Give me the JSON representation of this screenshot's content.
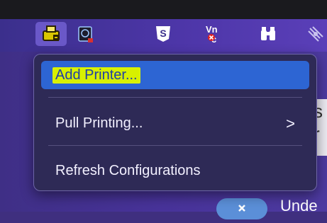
{
  "menubar": {
    "icons": [
      {
        "name": "printer-icon",
        "active": true
      },
      {
        "name": "capture-icon",
        "active": false
      },
      {
        "name": "s-badge-icon",
        "active": false
      },
      {
        "name": "vnc-icon",
        "active": false
      },
      {
        "name": "binoculars-icon",
        "active": false
      },
      {
        "name": "satellite-icon",
        "active": false
      }
    ],
    "vnc_label": "VNC"
  },
  "menu": {
    "items": [
      {
        "label": "Add Printer...",
        "selected": true,
        "submenu": false
      },
      {
        "label": "Pull Printing...",
        "selected": false,
        "submenu": true,
        "chevron": ">"
      },
      {
        "label": "Refresh Configurations",
        "selected": false,
        "submenu": false
      }
    ]
  },
  "background": {
    "right_letters": [
      "s",
      "r"
    ],
    "partial_text": "Unde"
  },
  "colors": {
    "menubar": "#4d36a8",
    "menu_bg": "#2e2a56",
    "selection": "#2d65d3",
    "highlight": "#d8f000"
  }
}
